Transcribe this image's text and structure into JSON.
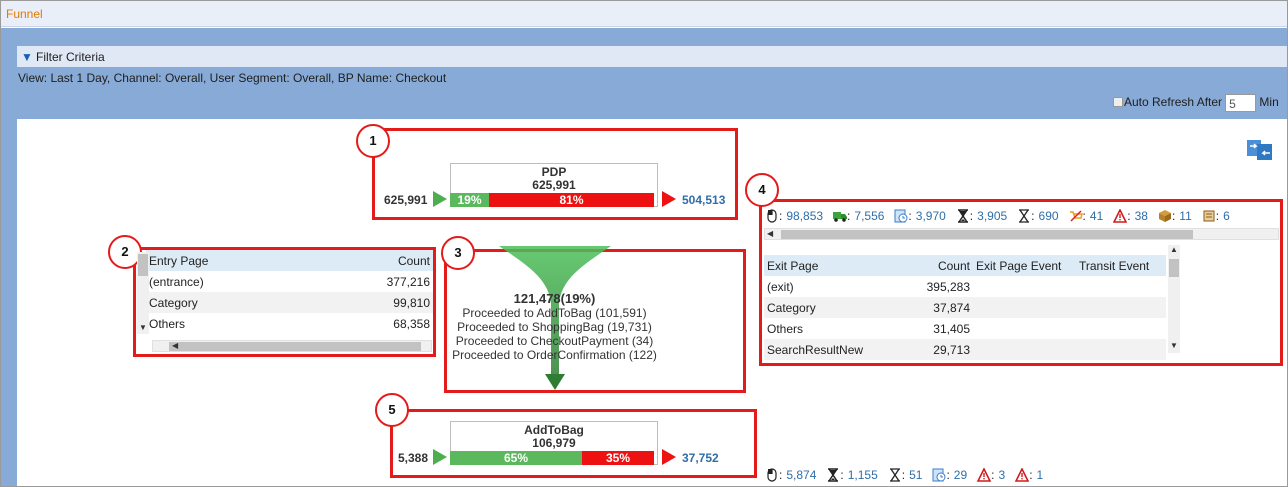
{
  "window": {
    "title": "Funnel"
  },
  "filter": {
    "header": "Filter Criteria",
    "summary": "View: Last 1 Day, Channel: Overall, User Segment: Overall, BP Name: Checkout",
    "auto_refresh_label": "Auto Refresh After",
    "auto_refresh_value": "5",
    "auto_refresh_unit": "Min"
  },
  "callouts": [
    "1",
    "2",
    "3",
    "4",
    "5"
  ],
  "stage1": {
    "name": "PDP",
    "count": "625,991",
    "in_count": "625,991",
    "out_count": "504,513",
    "proceed_pct": 19,
    "drop_pct": 81,
    "proceed_label": "19%",
    "drop_label": "81%"
  },
  "entry_table": {
    "headers": [
      "Entry Page",
      "Count"
    ],
    "rows": [
      [
        "(entrance)",
        "377,216"
      ],
      [
        "Category",
        "99,810"
      ],
      [
        "Others",
        "68,358"
      ]
    ]
  },
  "funnel": {
    "headline": "121,478(19%)",
    "lines": [
      "Proceeded to AddToBag (101,591)",
      "Proceeded to ShoppingBag (19,731)",
      "Proceeded to CheckoutPayment (34)",
      "Proceeded to OrderConfirmation (122)"
    ]
  },
  "exit_stats": [
    {
      "icon": "mouse-icon",
      "value": "98,853"
    },
    {
      "icon": "truck-icon",
      "value": "7,556"
    },
    {
      "icon": "page-clock-icon",
      "value": "3,970"
    },
    {
      "icon": "hourglass-icon",
      "value": "3,905"
    },
    {
      "icon": "hourglass-outline-icon",
      "value": "690"
    },
    {
      "icon": "broken-cart-icon",
      "value": "41"
    },
    {
      "icon": "warning-icon",
      "value": "38"
    },
    {
      "icon": "box-icon",
      "value": "11"
    },
    {
      "icon": "scroll-icon",
      "value": "6"
    }
  ],
  "exit_table": {
    "headers": [
      "Exit Page",
      "Count",
      "Exit Page Event",
      "Transit Event"
    ],
    "rows": [
      [
        "(exit)",
        "395,283",
        "",
        ""
      ],
      [
        "Category",
        "37,874",
        "",
        ""
      ],
      [
        "Others",
        "31,405",
        "",
        ""
      ],
      [
        "SearchResultNew",
        "29,713",
        "",
        ""
      ]
    ]
  },
  "stage2": {
    "name": "AddToBag",
    "count": "106,979",
    "in_count": "5,388",
    "out_count": "37,752",
    "proceed_pct": 65,
    "drop_pct": 35,
    "proceed_label": "65%",
    "drop_label": "35%"
  },
  "stage2_stats": [
    {
      "icon": "mouse-icon",
      "value": "5,874"
    },
    {
      "icon": "hourglass-icon",
      "value": "1,155"
    },
    {
      "icon": "hourglass-outline-icon",
      "value": "51"
    },
    {
      "icon": "page-clock-icon",
      "value": "29"
    },
    {
      "icon": "warning-icon",
      "value": "3"
    },
    {
      "icon": "warning-icon",
      "value": "1"
    }
  ],
  "colors": {
    "proceed": "#5cb85c",
    "drop": "#ee1111",
    "link": "#2f6ea8",
    "highlight": "#e31b1b",
    "header": "#88aad6"
  }
}
